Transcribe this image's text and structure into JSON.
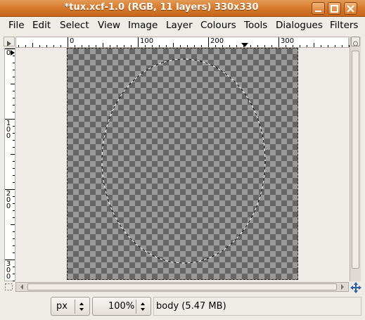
{
  "window": {
    "title": "*tux.xcf-1.0 (RGB, 11 layers) 330x330",
    "buttons": [
      "minimize",
      "maximize",
      "close"
    ]
  },
  "menu": {
    "items": [
      {
        "label": "File"
      },
      {
        "label": "Edit"
      },
      {
        "label": "Select"
      },
      {
        "label": "View"
      },
      {
        "label": "Image"
      },
      {
        "label": "Layer"
      },
      {
        "label": "Colours"
      },
      {
        "label": "Tools"
      },
      {
        "label": "Dialogues"
      },
      {
        "label": "Filters"
      }
    ]
  },
  "rulers": {
    "horizontal_labels": [
      "0",
      "100",
      "200",
      "300"
    ],
    "vertical_labels": [
      "0",
      "100",
      "200",
      "300"
    ]
  },
  "status": {
    "unit": "px",
    "zoom": "100%",
    "message": "body (5.47 MB)"
  },
  "colors": {
    "titlebar": "#d57a2c",
    "checker_light": "#999999",
    "checker_dark": "#666666",
    "layer_boundary": "#e6d000"
  },
  "icons": [
    "minimize-icon",
    "maximize-icon",
    "close-icon",
    "ruler-menu-icon",
    "zoom-lock-icon",
    "quick-mask-icon",
    "navigate-icon"
  ]
}
